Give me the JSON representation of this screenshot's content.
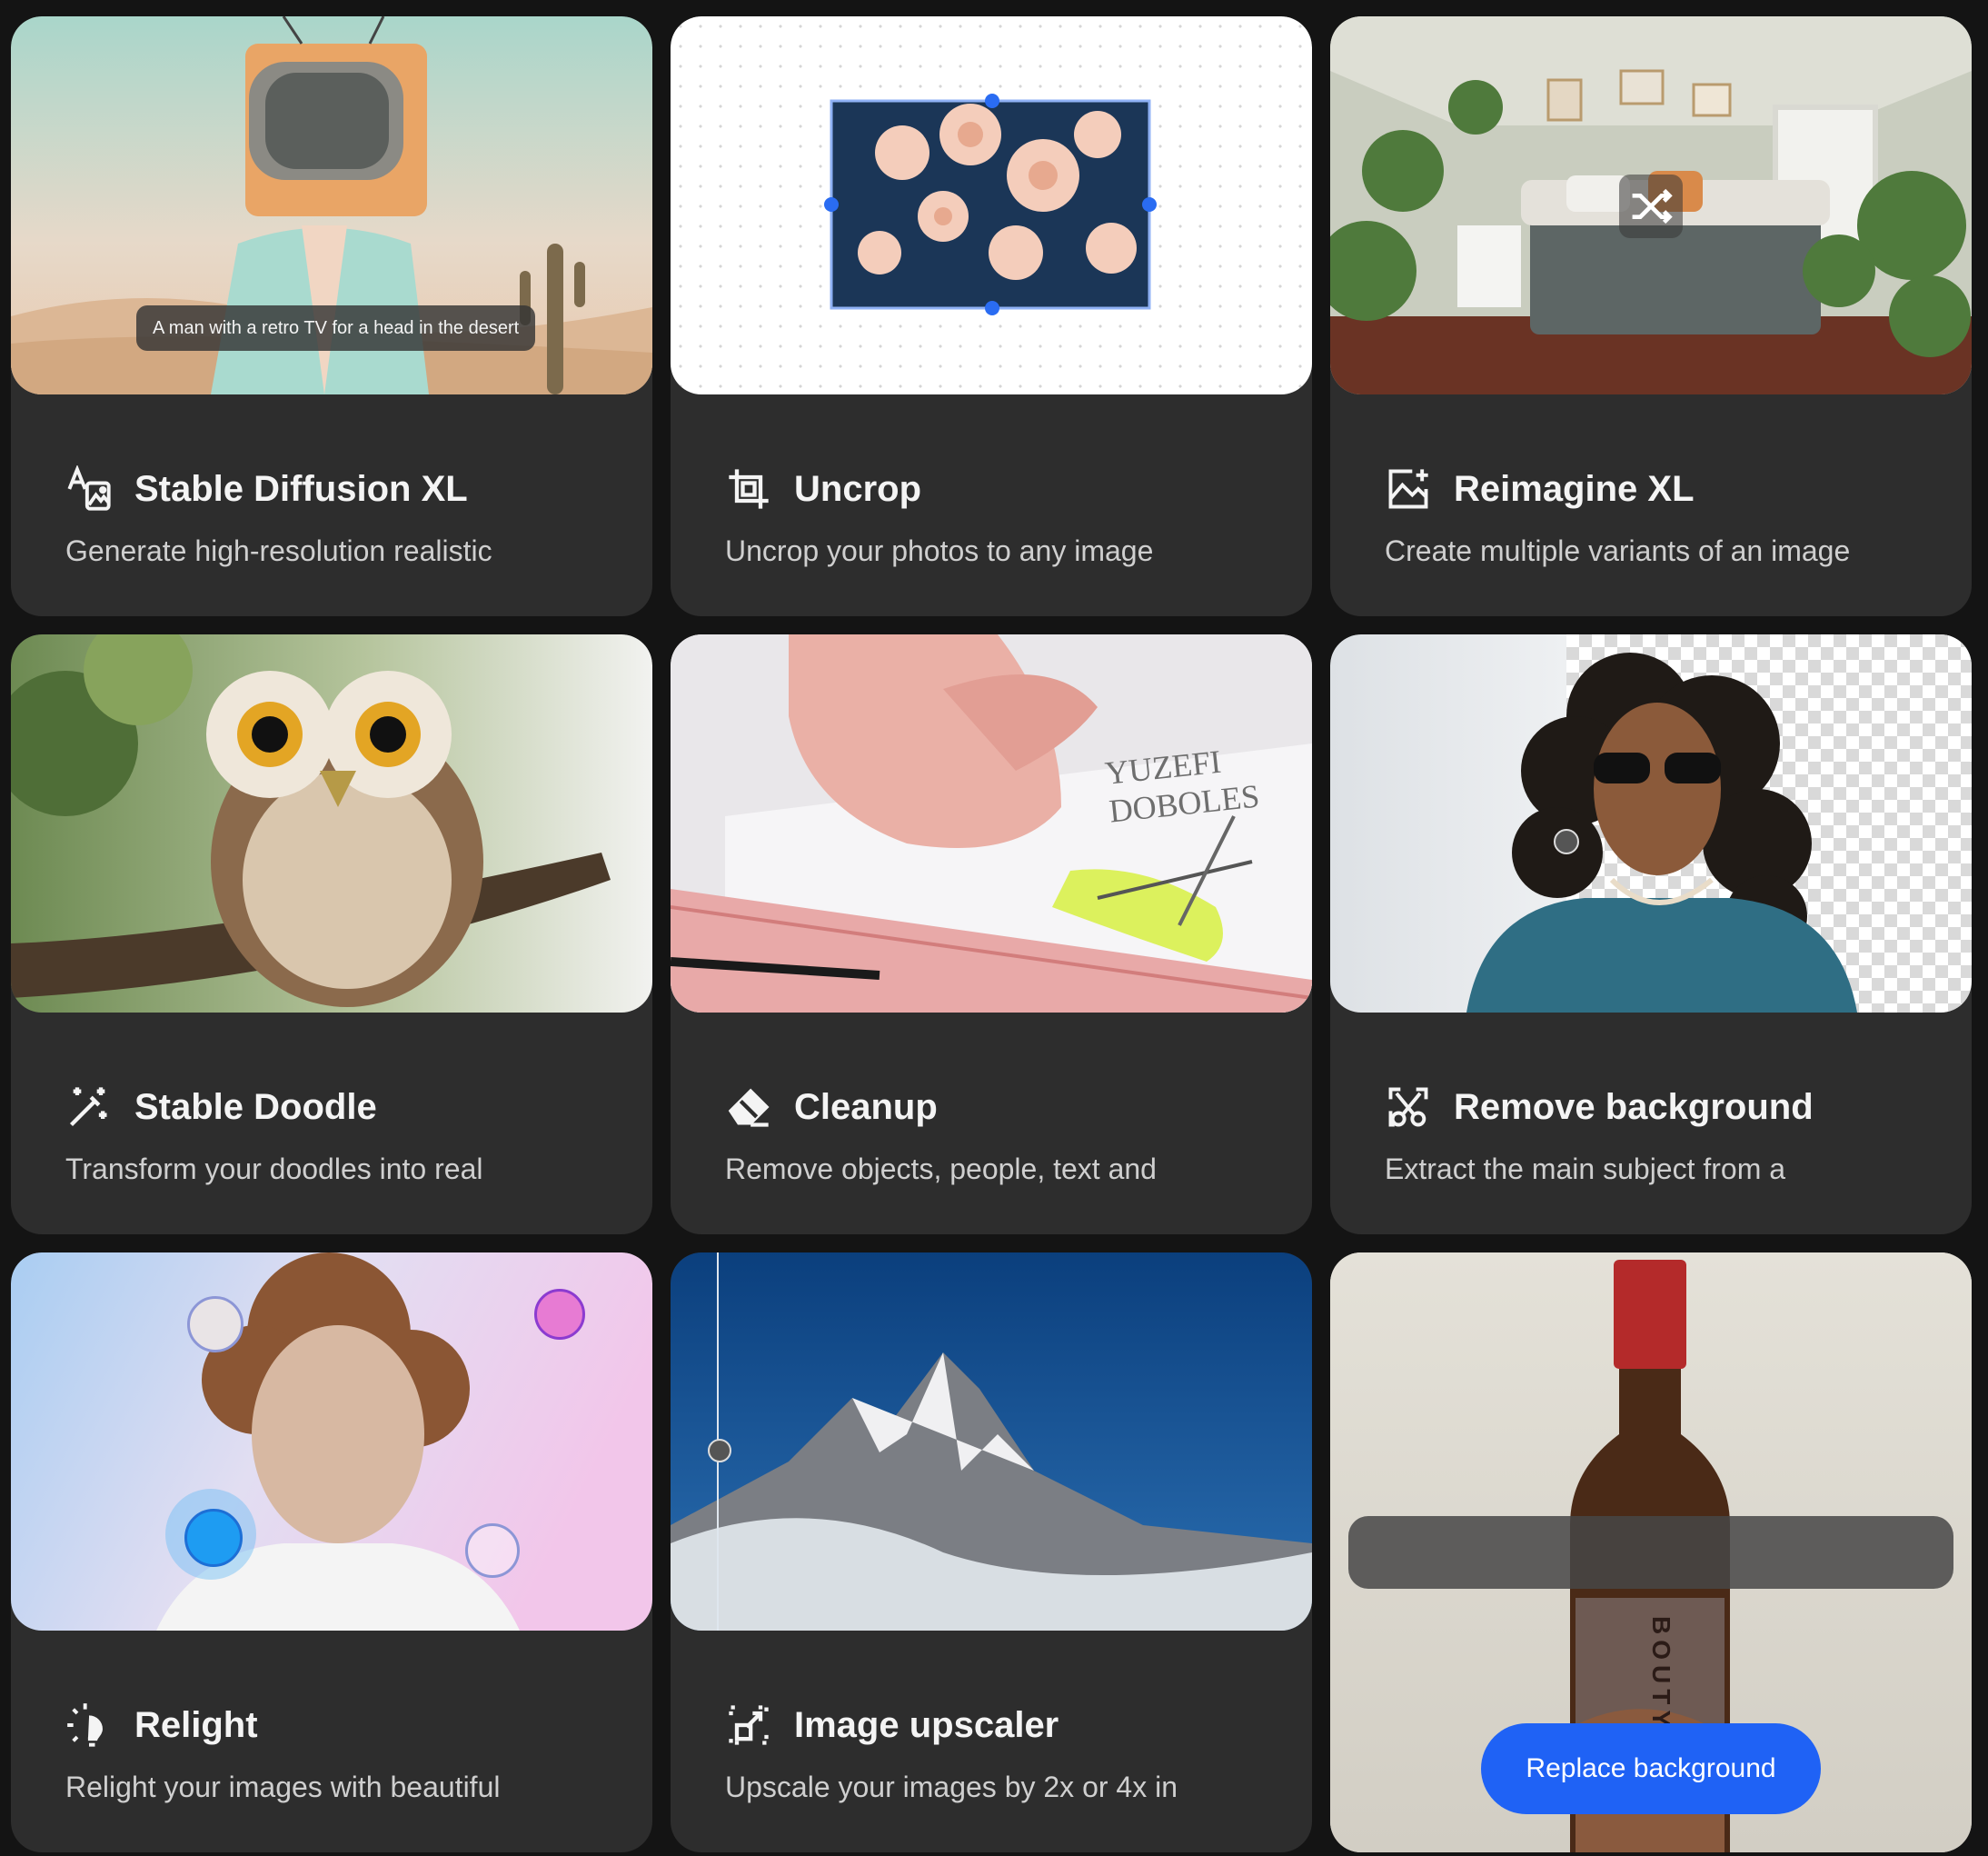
{
  "cards": [
    {
      "title": "Stable Diffusion XL",
      "description": "Generate high-resolution realistic",
      "caption": "A man with a retro TV for a head in the desert",
      "icon": "text-to-image-icon"
    },
    {
      "title": "Uncrop",
      "description": "Uncrop your photos to any image",
      "icon": "crop-icon"
    },
    {
      "title": "Reimagine XL",
      "description": "Create multiple variants of an image",
      "icon": "image-sparkle-icon",
      "overlay_icon": "shuffle-icon"
    },
    {
      "title": "Stable Doodle",
      "description": "Transform your doodles into real",
      "icon": "magic-wand-icon"
    },
    {
      "title": "Cleanup",
      "description": "Remove objects, people, text and",
      "icon": "eraser-icon",
      "ruler_text": "YUZEFI DOBOLES"
    },
    {
      "title": "Remove background",
      "description": "Extract the main subject from a",
      "icon": "cut-background-icon"
    },
    {
      "title": "Relight",
      "description": "Relight your images with beautiful",
      "icon": "lightbulb-icon"
    },
    {
      "title": "Image upscaler",
      "description": "Upscale your images by 2x or 4x in",
      "icon": "upscale-icon"
    },
    {
      "button": "Replace background",
      "bottle_label": "BOUTYA"
    }
  ]
}
